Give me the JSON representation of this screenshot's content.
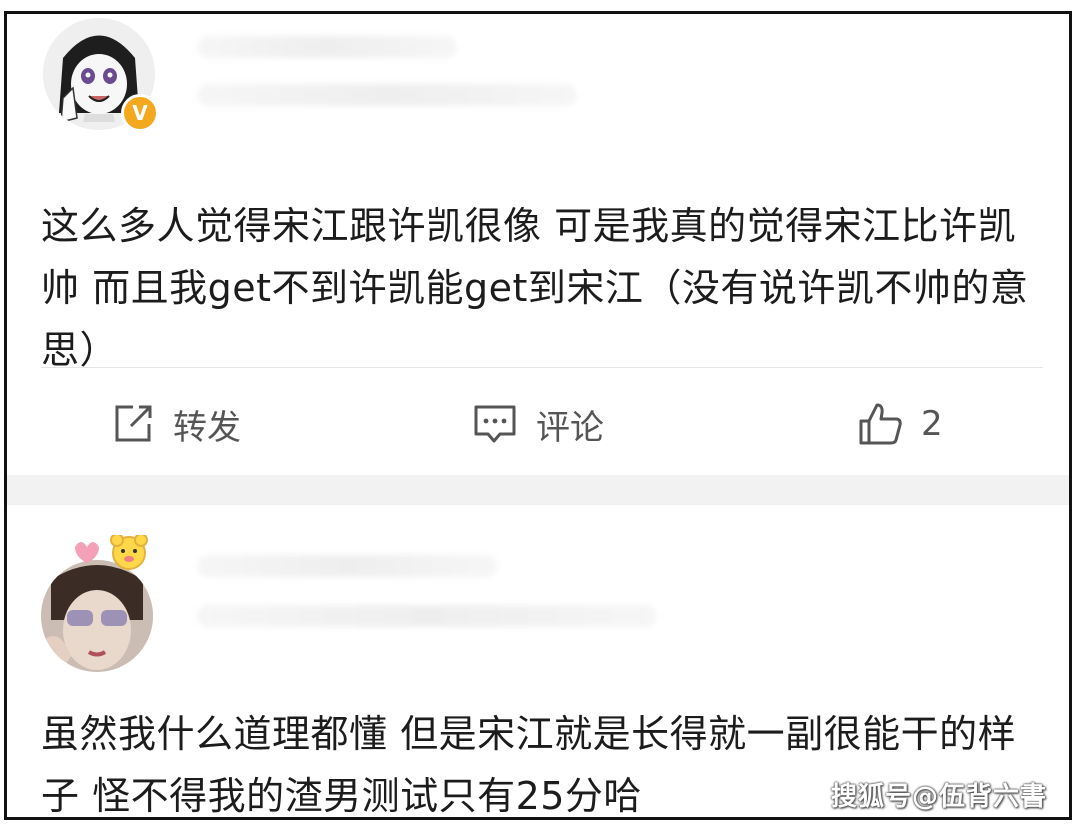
{
  "posts": [
    {
      "text": "这么多人觉得宋江跟许凯很像 可是我真的觉得宋江比许凯帅 而且我get不到许凯能get到宋江（没有说许凯不帅的意思）",
      "actions": {
        "repost_label": "转发",
        "comment_label": "评论",
        "like_count": "2"
      },
      "verified_badge": "V"
    },
    {
      "text": "虽然我什么道理都懂 但是宋江就是长得就一副很能干的样子 怪不得我的渣男测试只有25分哈"
    }
  ],
  "watermark": "搜狐号@伍背六書",
  "icons": {
    "repost": "edit-share-icon",
    "comment": "comment-bubble-icon",
    "like": "thumbs-up-icon"
  },
  "colors": {
    "verified": "#f4a81d",
    "divider_band": "#f2f2f2",
    "action_text": "#555555"
  }
}
